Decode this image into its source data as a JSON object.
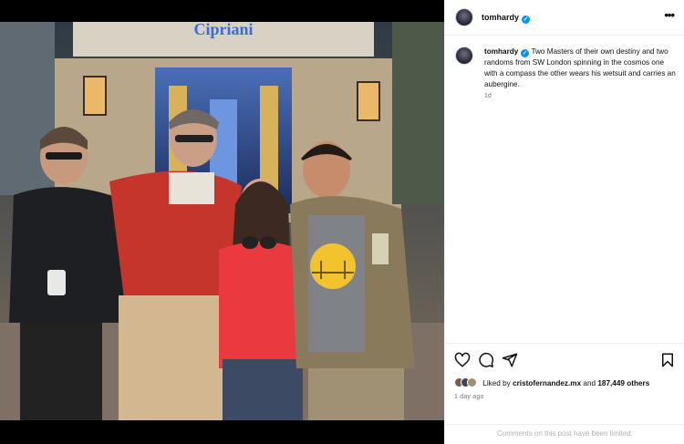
{
  "post": {
    "username": "tomhardy",
    "verified_mark": "✓",
    "more_label": "•••",
    "caption": "Two Masters of their own destiny and two randoms from SW London spinning in the cosmos one with a compass the other wears his wetsuit and carries an aubergine.",
    "caption_time": "1d",
    "sign_text": "Cipriani",
    "liked_by_prefix": "Liked by",
    "liked_by_user": "cristofernandez.mx",
    "liked_by_and": "and",
    "likes_count": "187,449 others",
    "posted_ago": "1 day ago",
    "comments_limited": "Comments on this post have been limited."
  },
  "icons": {
    "like": "heart-icon",
    "comment": "comment-icon",
    "share": "share-icon",
    "save": "bookmark-icon",
    "verified": "verified-badge-icon"
  },
  "colors": {
    "verified_blue": "#0095f6",
    "panel_bg": "#ffffff",
    "muted_text": "#737373"
  }
}
